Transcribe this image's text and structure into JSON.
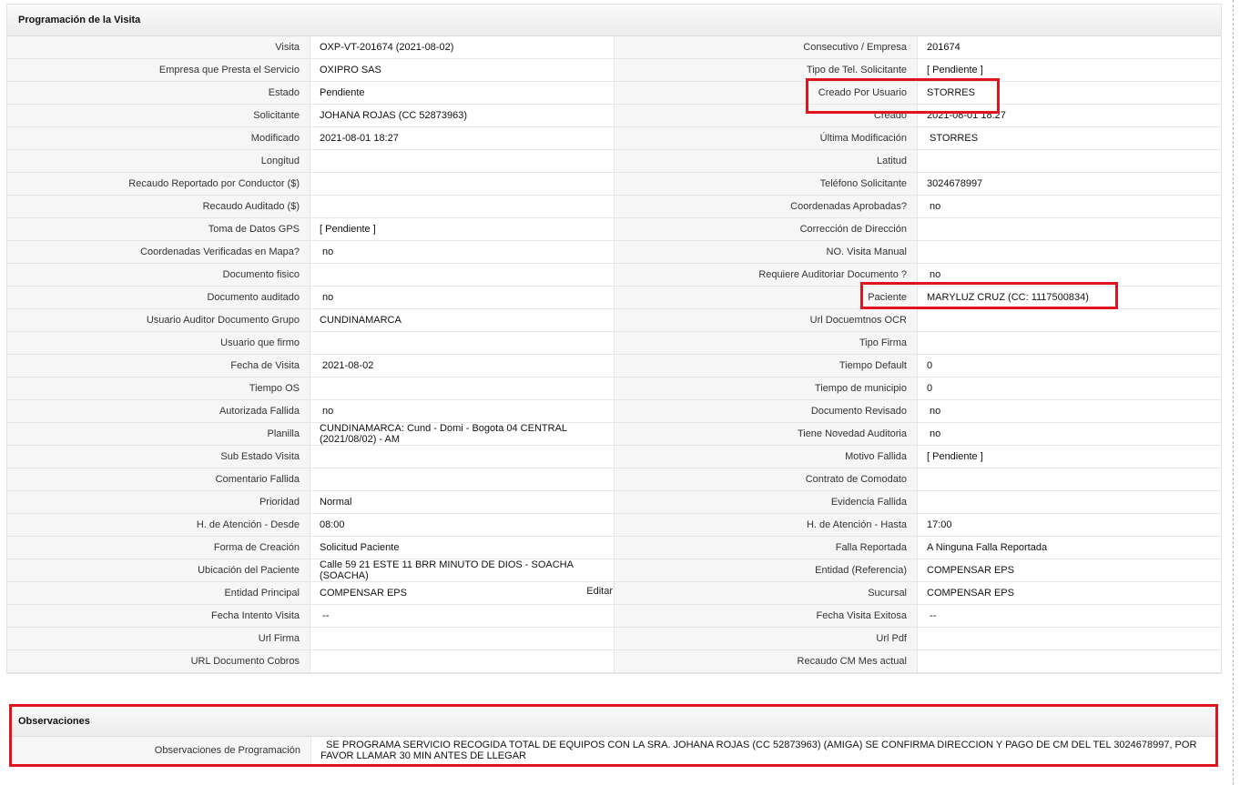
{
  "visit_panel": {
    "title": "Programación de la Visita",
    "rows": [
      {
        "l1": "Visita",
        "v1": "OXP-VT-201674 (2021-08-02)",
        "l2": "Consecutivo / Empresa",
        "v2": "201674"
      },
      {
        "l1": "Empresa que Presta el Servicio",
        "v1": "OXIPRO SAS",
        "l2": "Tipo de Tel. Solicitante",
        "v2": "[ Pendiente ]"
      },
      {
        "l1": "Estado",
        "v1": "Pendiente",
        "l2": "Creado Por Usuario",
        "v2": "STORRES"
      },
      {
        "l1": "Solicitante",
        "v1": "JOHANA ROJAS (CC 52873963)",
        "l2": "Creado",
        "v2": "2021-08-01 18:27"
      },
      {
        "l1": "Modificado",
        "v1": "2021-08-01 18:27",
        "l2": "Última Modificación",
        "v2": " STORRES"
      },
      {
        "l1": "Longitud",
        "v1": "",
        "l2": "Latitud",
        "v2": ""
      },
      {
        "l1": "Recaudo Reportado por Conductor ($)",
        "v1": "",
        "l2": "Teléfono Solicitante",
        "v2": "3024678997"
      },
      {
        "l1": "Recaudo Auditado ($)",
        "v1": "",
        "l2": "Coordenadas Aprobadas?",
        "v2": " no"
      },
      {
        "l1": "Toma de Datos GPS",
        "v1": "[ Pendiente ]",
        "l2": "Corrección de Dirección",
        "v2": ""
      },
      {
        "l1": "Coordenadas Verificadas en Mapa?",
        "v1": " no",
        "l2": "NO. Visita Manual",
        "v2": ""
      },
      {
        "l1": "Documento fisico",
        "v1": "",
        "l2": "Requiere Auditoriar Documento ?",
        "v2": " no"
      },
      {
        "l1": "Documento auditado",
        "v1": " no",
        "l2": "Paciente",
        "v2": "MARYLUZ CRUZ (CC: 1117500834)"
      },
      {
        "l1": "Usuario Auditor Documento Grupo",
        "v1": "CUNDINAMARCA",
        "l2": "Url Docuemtnos OCR",
        "v2": ""
      },
      {
        "l1": "Usuario que firmo",
        "v1": "",
        "l2": "Tipo Firma",
        "v2": ""
      },
      {
        "l1": "Fecha de Visita",
        "v1": " 2021-08-02",
        "l2": "Tiempo Default",
        "v2": "0"
      },
      {
        "l1": "Tiempo OS",
        "v1": "",
        "l2": "Tiempo de municipio",
        "v2": "0"
      },
      {
        "l1": "Autorizada Fallida",
        "v1": " no",
        "l2": "Documento Revisado",
        "v2": " no"
      },
      {
        "l1": "Planilla",
        "v1": "CUNDINAMARCA: Cund - Domi - Bogota 04 CENTRAL (2021/08/02) - AM",
        "l2": "Tiene Novedad Auditoria",
        "v2": " no"
      },
      {
        "l1": "Sub Estado Visita",
        "v1": "",
        "l2": "Motivo Fallida",
        "v2": "[ Pendiente ]"
      },
      {
        "l1": "Comentario Fallida",
        "v1": "",
        "l2": "Contrato de Comodato",
        "v2": ""
      },
      {
        "l1": "Prioridad",
        "v1": "Normal",
        "l2": "Evidencia Fallida",
        "v2": ""
      },
      {
        "l1": "H. de Atención - Desde",
        "v1": "08:00",
        "l2": "H. de Atención - Hasta",
        "v2": "17:00"
      },
      {
        "l1": "Forma de Creación",
        "v1": "Solicitud Paciente",
        "l2": "Falla Reportada",
        "v2": "A Ninguna Falla Reportada"
      },
      {
        "l1": "Ubicación del Paciente",
        "v1": "Calle 59 21 ESTE 11 BRR MINUTO DE DIOS - SOACHA (SOACHA)",
        "l2": "Entidad (Referencia)",
        "v2": "COMPENSAR EPS"
      },
      {
        "l1": "Entidad Principal",
        "v1": "COMPENSAR EPS",
        "l2": "Sucursal",
        "v2": "COMPENSAR EPS"
      },
      {
        "l1": "Fecha Intento Visita",
        "v1": " --",
        "l2": "Fecha Visita Exitosa",
        "v2": " --"
      },
      {
        "l1": "Url Firma",
        "v1": "",
        "l2": "Url Pdf",
        "v2": ""
      },
      {
        "l1": "URL Documento Cobros",
        "v1": "",
        "l2": "Recaudo CM Mes actual",
        "v2": ""
      }
    ],
    "edit_label": "Editar"
  },
  "observations_panel": {
    "title": "Observaciones",
    "label": "Observaciones de Programación",
    "value": "  SE PROGRAMA SERVICIO RECOGIDA TOTAL DE EQUIPOS CON LA SRA. JOHANA ROJAS (CC 52873963) (AMIGA) SE CONFIRMA DIRECCION Y PAGO DE CM DEL TEL 3024678997, POR FAVOR LLAMAR 30 MIN ANTES DE LLEGAR"
  },
  "colors": {
    "highlight": "#e0141e",
    "label_bg": "#f6f6f6",
    "border": "#e6e6e6"
  }
}
